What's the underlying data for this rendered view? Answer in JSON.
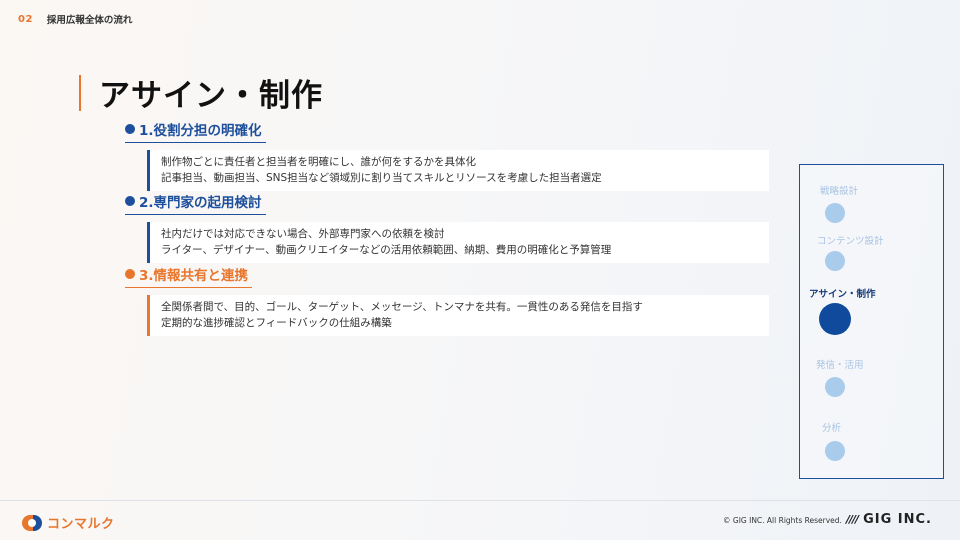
{
  "header": {
    "page_number": "02",
    "section_title": "採用広報全体の流れ"
  },
  "title": "アサイン・制作",
  "items": [
    {
      "title": "1.役割分担の明確化",
      "color": "#1d4f9c",
      "lines": [
        "制作物ごとに責任者と担当者を明確にし、誰が何をするかを具体化",
        "記事担当、動画担当、SNS担当など領域別に割り当てスキルとリソースを考慮した担当者選定"
      ]
    },
    {
      "title": "2.専門家の起用検討",
      "color": "#1d4f9c",
      "lines": [
        "社内だけでは対応できない場合、外部専門家への依頼を検討",
        "ライター、デザイナー、動画クリエイターなどの活用依頼範囲、納期、費用の明確化と予算管理"
      ]
    },
    {
      "title": "3.情報共有と連携",
      "color": "#e8762c",
      "lines": [
        "全関係者間で、目的、ゴール、ターゲット、メッセージ、トンマナを共有。一貫性のある発信を目指す",
        "定期的な進捗確認とフィードバックの仕組み構築"
      ]
    }
  ],
  "flow": {
    "steps": [
      {
        "label": "戦略設計",
        "active": false
      },
      {
        "label": "コンテンツ設計",
        "active": false
      },
      {
        "label": "アサイン・制作",
        "active": true
      },
      {
        "label": "発信・活用",
        "active": false
      },
      {
        "label": "分析",
        "active": false
      }
    ]
  },
  "footer": {
    "logo_text": "コンマルク",
    "copyright": "© GIG INC. All Rights Reserved.",
    "brand_slashes": "////",
    "brand_name": "GIG INC."
  },
  "colors": {
    "accent_orange": "#e8762c",
    "accent_blue": "#1d4f9c",
    "inactive_step": "#a9cbec"
  }
}
